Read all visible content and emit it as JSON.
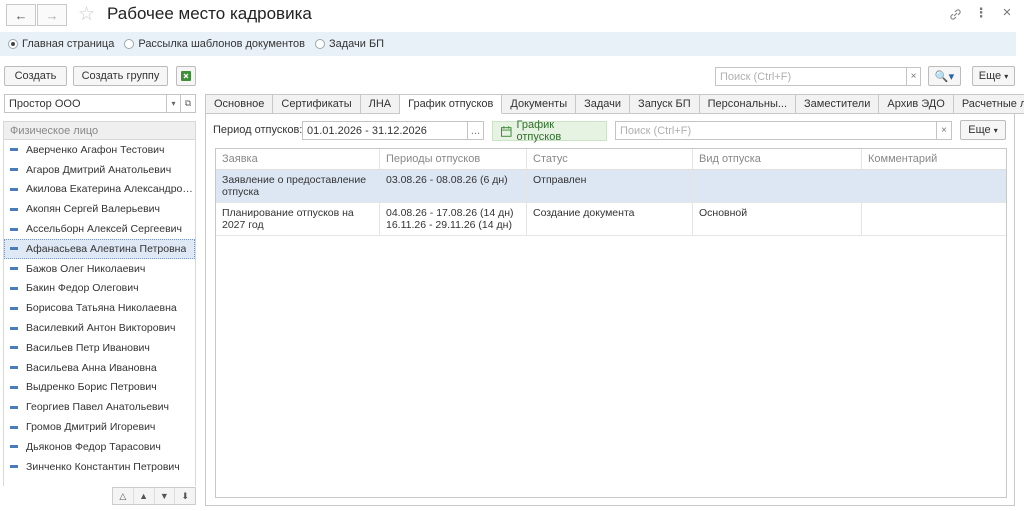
{
  "window": {
    "title": "Рабочее место кадровика"
  },
  "radios": [
    {
      "label": "Главная страница",
      "selected": true
    },
    {
      "label": "Рассылка шаблонов документов",
      "selected": false
    },
    {
      "label": "Задачи БП",
      "selected": false
    }
  ],
  "toolbar": {
    "create_label": "Создать",
    "create_group_label": "Создать группу",
    "search_placeholder": "Поиск (Ctrl+F)",
    "more_label": "Еще"
  },
  "organization": {
    "value": "Простор ООО"
  },
  "people_list": {
    "header": "Физическое лицо",
    "items": [
      "Аверченко Агафон Тестович",
      "Агаров Дмитрий Анатольевич",
      "Акилова Екатерина Александровна",
      "Акопян Сергей Валерьевич",
      "Ассельборн Алексей Сергеевич",
      "Афанасьева Алевтина Петровна",
      "Бажов Олег Николаевич",
      "Бакин Федор Олегович",
      "Борисова Татьяна Николаевна",
      "Василевкий Антон Викторович",
      "Васильев Петр Иванович",
      "Васильева Анна Ивановна",
      "Выдренко Борис Петрович",
      "Георгиев Павел Анатольевич",
      "Громов Дмитрий Игоревич",
      "Дьяконов Федор Тарасович",
      "Зинченко Константин Петрович"
    ],
    "selected_index": 5
  },
  "tabs": [
    {
      "label": "Основное"
    },
    {
      "label": "Сертификаты"
    },
    {
      "label": "ЛНА"
    },
    {
      "label": "График отпусков",
      "active": true
    },
    {
      "label": "Документы"
    },
    {
      "label": "Задачи"
    },
    {
      "label": "Запуск БП"
    },
    {
      "label": "Персональны..."
    },
    {
      "label": "Заместители"
    },
    {
      "label": "Архив ЭДО"
    },
    {
      "label": "Расчетные ли..."
    }
  ],
  "vacation": {
    "period_label": "Период отпусков:",
    "period_value": "01.01.2026 - 31.12.2026",
    "schedule_button": "График отпусков",
    "search_placeholder": "Поиск (Ctrl+F)",
    "more_label": "Еще",
    "columns": [
      "Заявка",
      "Периоды отпусков",
      "Статус",
      "Вид отпуска",
      "Комментарий"
    ],
    "rows": [
      {
        "request": "Заявление о предоставление отпуска",
        "periods": [
          "03.08.26 - 08.08.26 (6 дн)"
        ],
        "status": "Отправлен",
        "kind": "",
        "comment": "",
        "selected": true
      },
      {
        "request": "Планирование отпусков на 2027 год",
        "periods": [
          "04.08.26 - 17.08.26 (14 дн)",
          "16.11.26 - 29.11.26 (14 дн)"
        ],
        "status": "Создание документа",
        "kind": "Основной",
        "comment": "",
        "selected": false
      }
    ]
  },
  "colors": {
    "radio_bar_bg": "#e8f0f8",
    "selected_row": "#dce7f3",
    "list_marker": "#4a7bbd",
    "green_button": "#2f6f2a"
  }
}
